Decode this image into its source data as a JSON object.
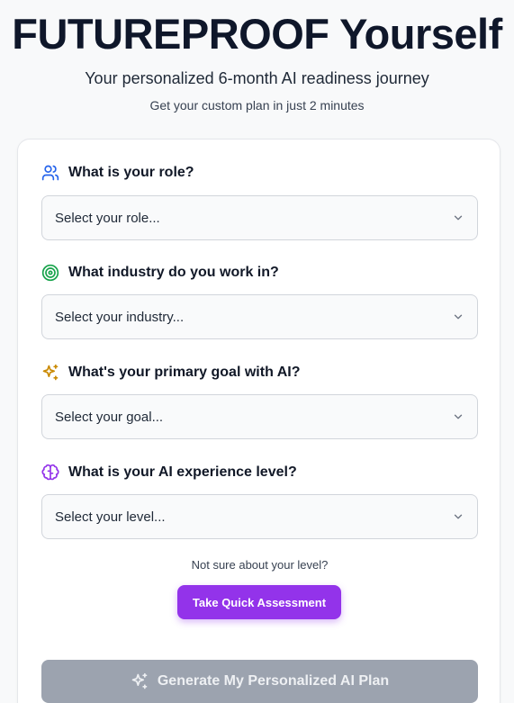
{
  "hero": {
    "title": "FUTUREPROOF Yourself",
    "subtitle": "Your personalized 6-month AI readiness journey",
    "caption": "Get your custom plan in just 2 minutes"
  },
  "form": {
    "questions": [
      {
        "icon": "users-icon",
        "icon_color": "#2563eb",
        "label": "What is your role?",
        "placeholder": "Select your role..."
      },
      {
        "icon": "target-icon",
        "icon_color": "#16a34a",
        "label": "What industry do you work in?",
        "placeholder": "Select your industry..."
      },
      {
        "icon": "sparkles-icon",
        "icon_color": "#ca8a04",
        "label": "What's your primary goal with AI?",
        "placeholder": "Select your goal..."
      },
      {
        "icon": "brain-icon",
        "icon_color": "#9333ea",
        "label": "What is your AI experience level?",
        "placeholder": "Select your level..."
      }
    ],
    "not_sure_text": "Not sure about your level?",
    "assessment_button_label": "Take Quick Assessment",
    "generate_button_label": "Generate My Personalized AI Plan"
  },
  "colors": {
    "accent": "#9333ea",
    "disabled_button": "#9ca3af"
  }
}
